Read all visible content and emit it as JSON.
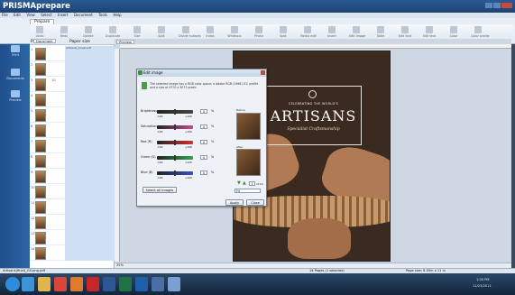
{
  "app": {
    "title": "PRISMAprepare"
  },
  "menu": [
    "File",
    "Edit",
    "View",
    "Select",
    "Insert",
    "Document",
    "Tools",
    "Help"
  ],
  "ribbon": {
    "tab": "Prepare",
    "buttons": [
      "Undo",
      "Redo",
      "Delete",
      "Duplicate",
      "Size",
      "Split",
      "Divide subsets",
      "Index",
      "Whiteout",
      "Photo",
      "Split",
      "Media edit",
      "Insert",
      "Edit image",
      "Table",
      "Edit font",
      "Edit text",
      "Color",
      "Color profile"
    ]
  },
  "sidebar": {
    "items": [
      {
        "label": "Prepare"
      },
      {
        "label": "Print"
      },
      {
        "label": "Documents"
      },
      {
        "label": "Preview"
      }
    ]
  },
  "thumbs": {
    "tab": "Document",
    "col_page": "Page",
    "col_paper": "Paper size",
    "rows": [
      {
        "num": "1",
        "count": "",
        "detail": "Artisans_Cover.pdf"
      },
      {
        "num": "2",
        "count": "",
        "detail": ""
      },
      {
        "num": "3",
        "count": "10",
        "detail": ""
      },
      {
        "num": "4",
        "count": "",
        "detail": ""
      },
      {
        "num": "5",
        "count": "",
        "detail": ""
      },
      {
        "num": "6",
        "count": "",
        "detail": ""
      },
      {
        "num": "7",
        "count": "",
        "detail": ""
      },
      {
        "num": "8",
        "count": "",
        "detail": ""
      },
      {
        "num": "9",
        "count": "",
        "detail": ""
      },
      {
        "num": "10",
        "count": "",
        "detail": ""
      },
      {
        "num": "11",
        "count": "",
        "detail": ""
      },
      {
        "num": "12",
        "count": "",
        "detail": ""
      },
      {
        "num": "13",
        "count": "",
        "detail": ""
      },
      {
        "num": "14",
        "count": "",
        "detail": ""
      }
    ]
  },
  "preview_tab": "Preview",
  "page": {
    "line1": "CELEBRATING THE WORLD'S",
    "title": "ARTISANS",
    "subtitle": "Specialist Craftsmanship"
  },
  "dialog": {
    "title": "Edit image",
    "info": "The selected image has a RGB color space; a Adobe RGB (1998) ICC profile and a size of 4770 x 3077 pixels",
    "rows": [
      {
        "label": "Brightness",
        "value": "0",
        "min": "-100",
        "max": "+100",
        "unit": "%",
        "color": "#444444",
        "pos": 0.5
      },
      {
        "label": "Saturation",
        "value": "0",
        "min": "-100",
        "max": "+100",
        "unit": "%",
        "color": "#c94a8e",
        "pos": 0.5
      },
      {
        "label": "Red (R)",
        "value": "0",
        "min": "-100",
        "max": "+100",
        "unit": "%",
        "color": "#d33030",
        "pos": 0.5
      },
      {
        "label": "Green (G)",
        "value": "0",
        "min": "-100",
        "max": "+100",
        "unit": "%",
        "color": "#2fa34a",
        "pos": 0.5
      },
      {
        "label": "Blue (B)",
        "value": "0",
        "min": "-100",
        "max": "+100",
        "unit": "%",
        "color": "#3450c9",
        "pos": 0.5
      }
    ],
    "before_label": "Before",
    "after_label": "After",
    "page_value": "1",
    "page_total": "of 14",
    "fit_value": "Fit",
    "select_all": "Select all images",
    "apply": "Apply",
    "close": "Close"
  },
  "zoom": "25%",
  "status": {
    "left": "Artisans(final)_GS.png.pdf",
    "mid": "14 Pages (1 selected)",
    "right": "Page size: 8.50in x 11 in"
  },
  "tray": {
    "time": "1:00 PM",
    "date": "11/23/2011"
  },
  "taskbar_apps": [
    {
      "name": "start",
      "color": "#2f8bd8"
    },
    {
      "name": "ie",
      "color": "#3c93d5"
    },
    {
      "name": "explorer",
      "color": "#e0b54a"
    },
    {
      "name": "chrome",
      "color": "#d8453a"
    },
    {
      "name": "firefox",
      "color": "#e07a2e"
    },
    {
      "name": "acrobat",
      "color": "#c7262b"
    },
    {
      "name": "word",
      "color": "#2b5797"
    },
    {
      "name": "excel",
      "color": "#207245"
    },
    {
      "name": "outlook",
      "color": "#1f5ea8"
    },
    {
      "name": "prisma",
      "color": "#4a6fa5"
    },
    {
      "name": "paint",
      "color": "#7b9fd1"
    }
  ]
}
